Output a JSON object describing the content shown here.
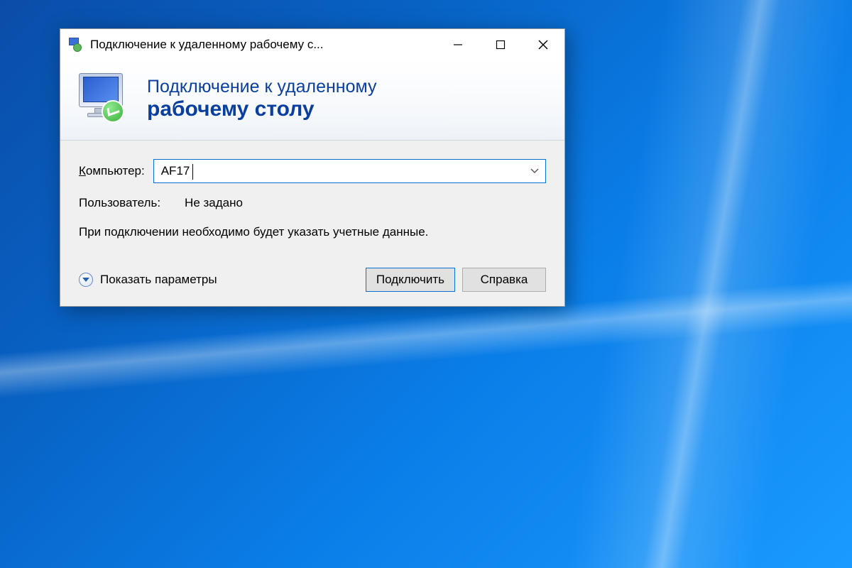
{
  "window": {
    "title": "Подключение к удаленному рабочему с..."
  },
  "banner": {
    "line1": "Подключение к удаленному",
    "line2": "рабочему столу"
  },
  "form": {
    "computer_label_prefix": "К",
    "computer_label_rest": "омпьютер:",
    "computer_value": "AF17",
    "user_label": "Пользователь:",
    "user_value": "Не задано",
    "info_text": "При подключении необходимо будет указать учетные данные."
  },
  "footer": {
    "show_options_prefix": "П",
    "show_options_rest": "оказать параметры",
    "connect_prefix": "П",
    "connect_rest": "одключить",
    "help_prefix": "С",
    "help_rest": "правка"
  }
}
